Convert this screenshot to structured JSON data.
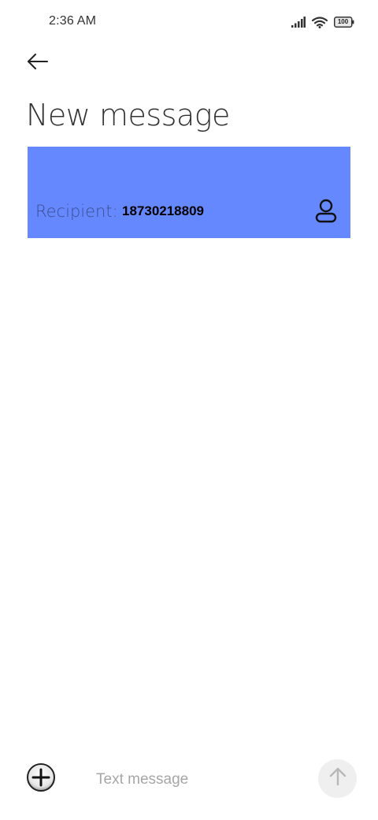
{
  "status_bar": {
    "time": "2:36 AM",
    "battery_level": "100",
    "icons": [
      "signal-icon",
      "wifi-icon",
      "battery-icon"
    ]
  },
  "header": {
    "back_icon": "arrow-left-icon",
    "title": "New message"
  },
  "recipient": {
    "label": "Recipient:",
    "value": "18730218809",
    "contact_icon": "person-icon",
    "highlight_color": "#6688ff"
  },
  "composer": {
    "attach_icon": "plus-circle-icon",
    "placeholder": "Text message",
    "send_icon": "arrow-up-icon"
  }
}
